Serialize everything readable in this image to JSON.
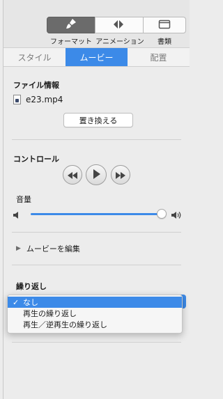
{
  "toolbar": {
    "buttons": [
      {
        "label": "フォーマット",
        "icon": "paintbrush-icon",
        "active": true
      },
      {
        "label": "アニメーション",
        "icon": "diamond-icon",
        "active": false
      },
      {
        "label": "書類",
        "icon": "document-icon",
        "active": false
      }
    ]
  },
  "tabs": [
    {
      "label": "スタイル",
      "active": false
    },
    {
      "label": "ムービー",
      "active": true
    },
    {
      "label": "配置",
      "active": false
    }
  ],
  "file_info": {
    "title": "ファイル情報",
    "file_name": "e23.mp4",
    "replace_label": "置き換える"
  },
  "controls": {
    "title": "コントロール",
    "volume_label": "音量",
    "volume_level": 0.98
  },
  "edit_movie": {
    "label": "ムービーを編集"
  },
  "repeat": {
    "title": "繰り返し",
    "options": [
      {
        "label": "なし",
        "selected": true
      },
      {
        "label": "再生の繰り返し",
        "selected": false
      },
      {
        "label": "再生／逆再生の繰り返し",
        "selected": false
      }
    ]
  },
  "colors": {
    "accent": "#3c8ae8"
  }
}
